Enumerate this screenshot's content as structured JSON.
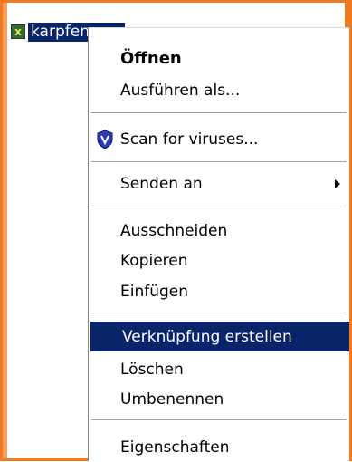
{
  "desktop": {
    "file_name": "karpfen.exe"
  },
  "context_menu": {
    "items": {
      "open": "Öffnen",
      "run_as": "Ausführen als...",
      "scan": "Scan for viruses...",
      "send_to": "Senden an",
      "cut": "Ausschneiden",
      "copy": "Kopieren",
      "paste": "Einfügen",
      "create_shortcut": "Verknüpfung erstellen",
      "delete": "Löschen",
      "rename": "Umbenennen",
      "properties": "Eigenschaften"
    },
    "highlighted": "create_shortcut"
  },
  "colors": {
    "selection": "#0a246a",
    "frame_border": "#ef7a20",
    "shield": "#2d3bb8"
  },
  "icons": {
    "file": "exe-file-icon",
    "scan": "shield-icon",
    "send_to_arrow": "chevron-right-icon"
  }
}
